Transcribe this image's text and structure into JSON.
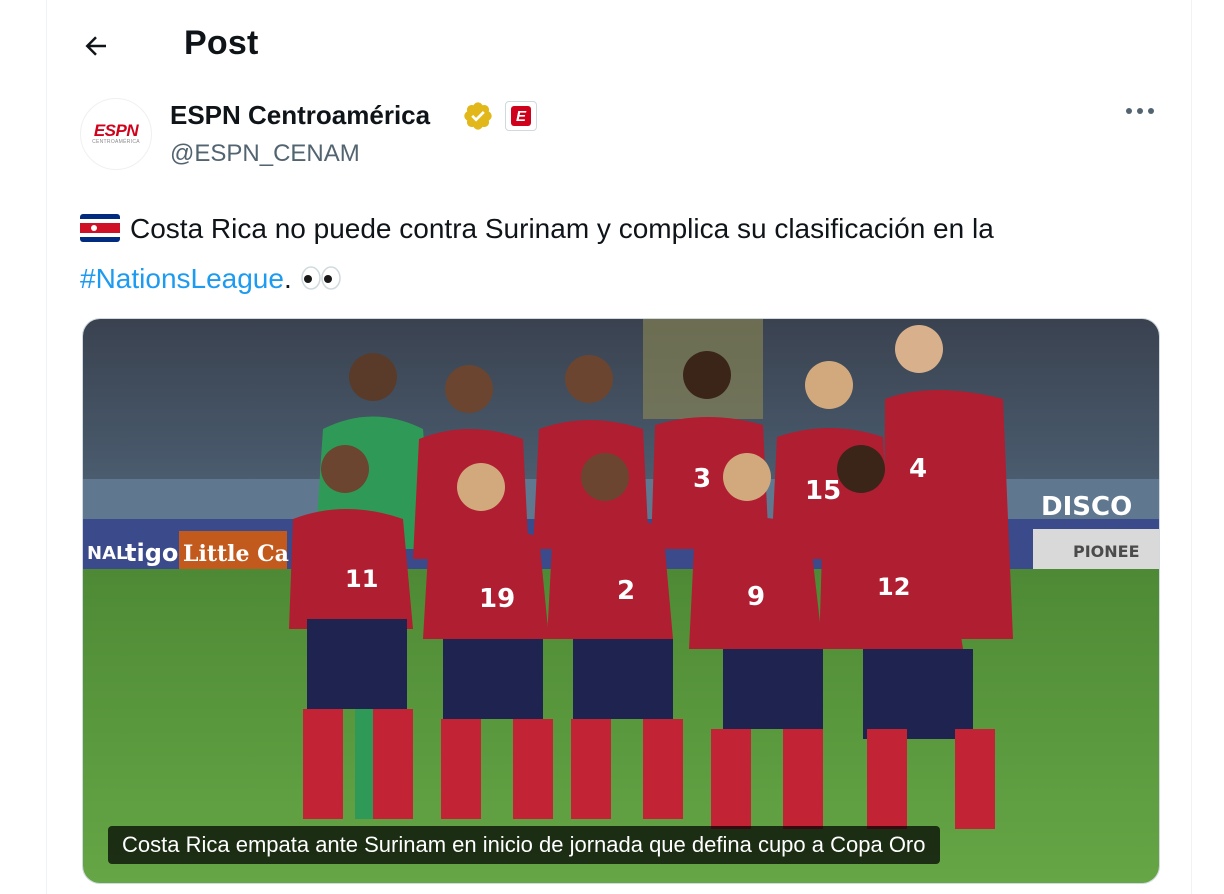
{
  "header": {
    "title": "Post",
    "back_icon": "arrow-left-icon"
  },
  "author": {
    "display_name": "ESPN Centroamérica",
    "handle": "@ESPN_CENAM",
    "avatar_text": "ESPN",
    "avatar_subtext": "CENTROAMÉRICA",
    "verified_icon": "verified-gold-badge-icon",
    "affiliate_badge_text": "E",
    "more_icon": "more-horizontal-icon"
  },
  "tweet": {
    "flag_icon": "costa-rica-flag-icon",
    "text": "Costa Rica no puede contra Surinam y complica su clasificación en la",
    "hashtag": "#NationsLeague",
    "suffix": ".",
    "emoji_icon": "eyes-emoji-icon"
  },
  "media": {
    "caption": "Costa Rica empata ante Surinam en inicio de jornada que defina cupo a Copa Oro",
    "ad_boards": [
      "NAL",
      "tigo",
      "Little Ca",
      "DISCO",
      "PIONEE"
    ],
    "jersey_numbers_back": [
      "3",
      "15",
      "4"
    ],
    "jersey_numbers_front": [
      "11",
      "19",
      "2",
      "9",
      "12"
    ]
  },
  "colors": {
    "brand_red": "#d0021b",
    "link_blue": "#1d9bf0",
    "verified_gold": "#e2b719",
    "jersey_red": "#b01e32",
    "shorts_navy": "#1f2350",
    "pitch_green": "#5d9a3e"
  }
}
